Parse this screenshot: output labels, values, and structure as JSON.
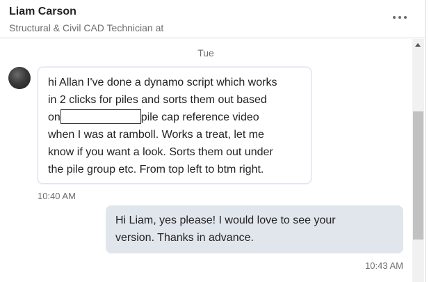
{
  "header": {
    "contact_name": "Liam Carson",
    "headline": "Structural & Civil CAD Technician at",
    "more_label": "More options"
  },
  "thread": {
    "day_label": "Tue",
    "messages": [
      {
        "direction": "incoming",
        "lines": [
          "hi Allan I've done a dynamo script which works",
          "in 2 clicks for piles and sorts them out based",
          "on",
          "pile cap reference video",
          "when I was at ramboll. Works a treat, let me",
          "know if you want a look. Sorts them out under",
          "the pile group etc. From top left to btm right."
        ],
        "time": "10:40 AM"
      },
      {
        "direction": "outgoing",
        "lines": [
          "Hi Liam, yes please! I would love to see your",
          "version. Thanks in advance."
        ],
        "time": "10:43 AM"
      }
    ]
  },
  "icons": {
    "more": "more-horizontal-icon",
    "scroll_up": "caret-up-icon"
  },
  "colors": {
    "outgoing_bubble": "#e1e6ed",
    "incoming_border": "#dfe4f1",
    "muted_text": "#6b6e70",
    "scroll_thumb": "#c1c1c1"
  }
}
